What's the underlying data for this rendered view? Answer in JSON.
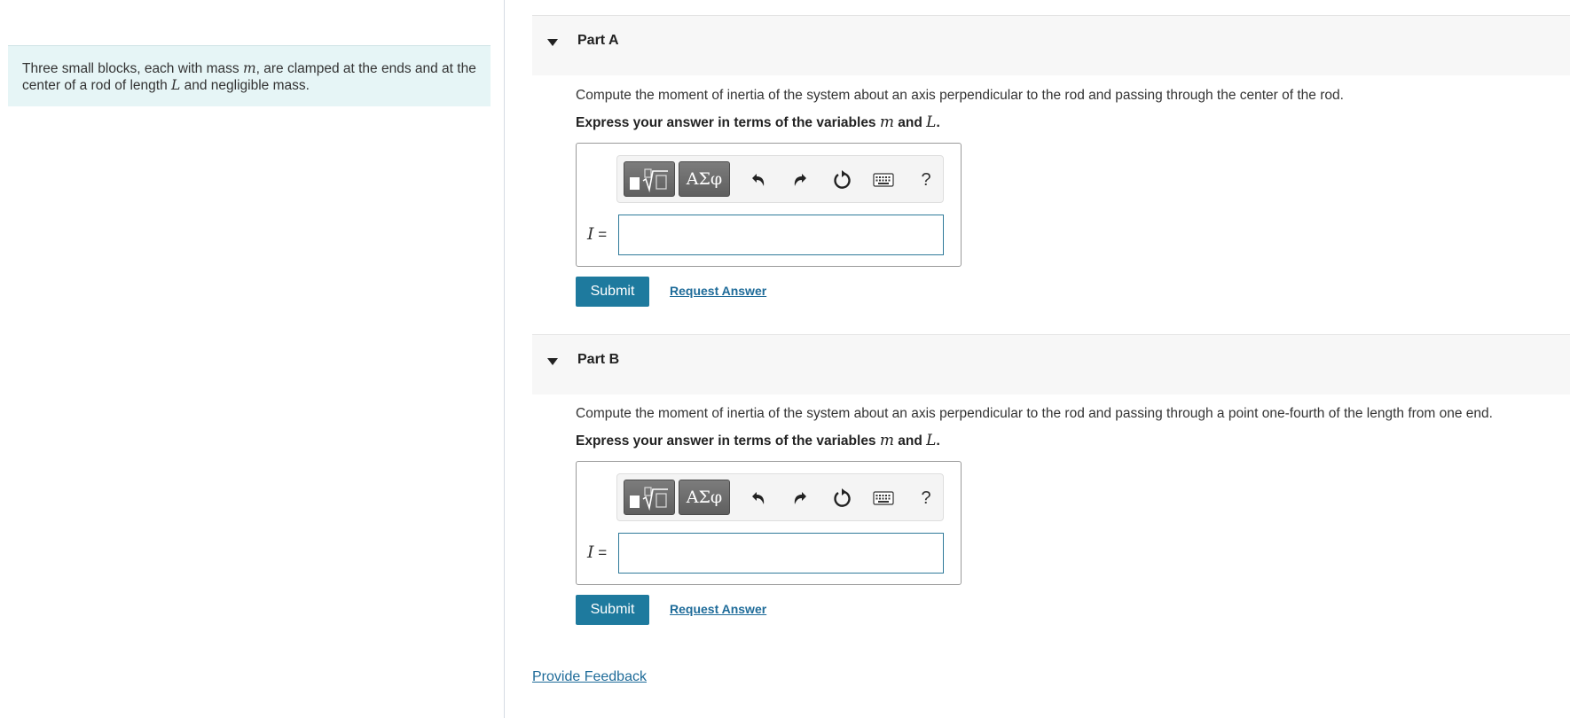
{
  "problem": {
    "text_before_m": "Three small blocks, each with mass ",
    "var_m": "m",
    "text_after_m": ", are clamped at the ends and at the center of a rod of length ",
    "var_L": "L",
    "text_after_L": " and negligible mass."
  },
  "parts": [
    {
      "title": "Part A",
      "question": "Compute the moment of inertia of the system about an axis perpendicular to the rod and passing through the center of the rod.",
      "instruction_prefix": "Express your answer in terms of the variables ",
      "var_m": "m",
      "instruction_and": " and ",
      "var_L": "L",
      "instruction_period": ".",
      "toolbar": {
        "greek_label": "ΑΣφ",
        "help_label": "?"
      },
      "input_var": "I",
      "input_eq": " =",
      "input_value": "",
      "submit_label": "Submit",
      "request_label": "Request Answer"
    },
    {
      "title": "Part B",
      "question": "Compute the moment of inertia of the system about an axis perpendicular to the rod and passing through a point one-fourth of the length from one end.",
      "instruction_prefix": "Express your answer in terms of the variables ",
      "var_m": "m",
      "instruction_and": " and ",
      "var_L": "L",
      "instruction_period": ".",
      "toolbar": {
        "greek_label": "ΑΣφ",
        "help_label": "?"
      },
      "input_var": "I",
      "input_eq": " =",
      "input_value": "",
      "submit_label": "Submit",
      "request_label": "Request Answer"
    }
  ],
  "feedback_label": "Provide Feedback",
  "icons": {
    "collapse": "caret-down-icon",
    "templates": "templates-icon",
    "undo": "undo-icon",
    "redo": "redo-icon",
    "reset": "reset-icon",
    "keyboard": "keyboard-icon",
    "help": "help-icon"
  },
  "colors": {
    "accent": "#1e7a9e",
    "link": "#1e6b99",
    "problem_bg": "#e6f5f6"
  }
}
